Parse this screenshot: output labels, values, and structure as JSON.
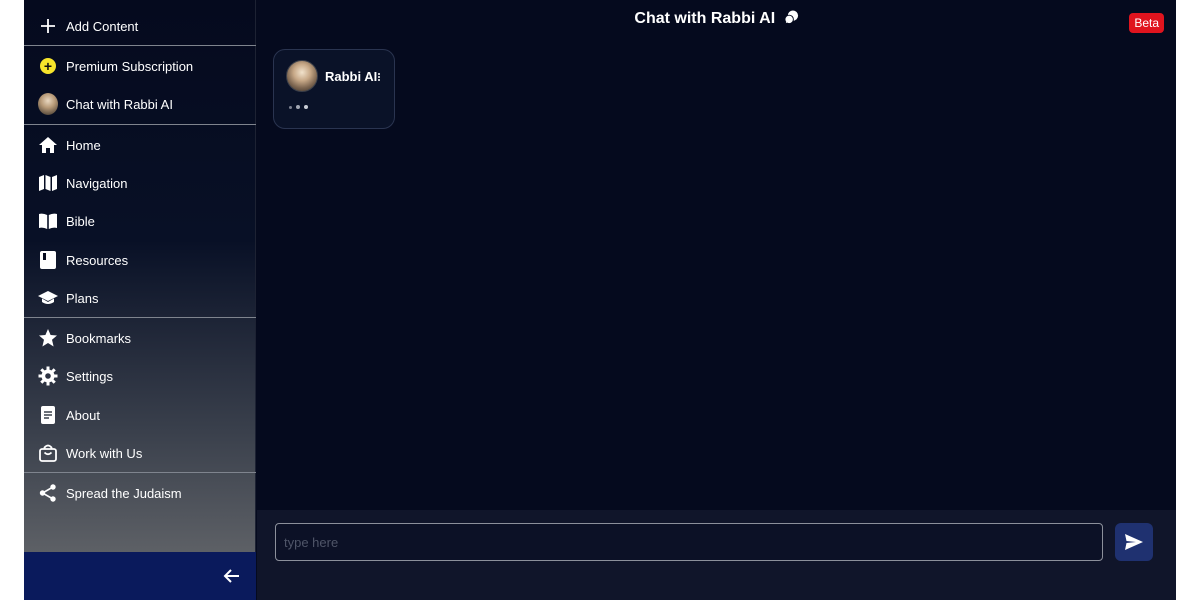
{
  "sidebar": {
    "add_content": "Add Content",
    "premium": "Premium Subscription",
    "chat": "Chat with Rabbi AI",
    "nav": {
      "home": "Home",
      "navigation": "Navigation",
      "bible": "Bible",
      "resources": "Resources",
      "plans": "Plans"
    },
    "bookmarks": "Bookmarks",
    "settings": "Settings",
    "about": "About",
    "work": "Work with Us",
    "spread": "Spread the Judaism",
    "icons": {
      "add_content": "plus-icon",
      "premium": "plus-circle-icon",
      "chat": "rabbi-avatar",
      "home": "home-icon",
      "navigation": "map-icon",
      "bible": "book-open-icon",
      "resources": "book-icon",
      "plans": "graduation-cap-icon",
      "bookmarks": "star-icon",
      "settings": "gear-icon",
      "about": "document-icon",
      "work": "shopping-bag-icon",
      "spread": "share-icon",
      "back": "arrow-left-icon"
    }
  },
  "header": {
    "title": "Chat with Rabbi AI",
    "badge": "Beta"
  },
  "chat": {
    "messages": [
      {
        "sender": "Rabbi AI",
        "status": "typing"
      }
    ]
  },
  "composer": {
    "placeholder": "type here",
    "value": ""
  },
  "colors": {
    "background": "#050a1e",
    "badge": "#e0141e",
    "premium": "#f7e52b",
    "send_button": "#1f3170",
    "footer": "#0a1a5c"
  }
}
